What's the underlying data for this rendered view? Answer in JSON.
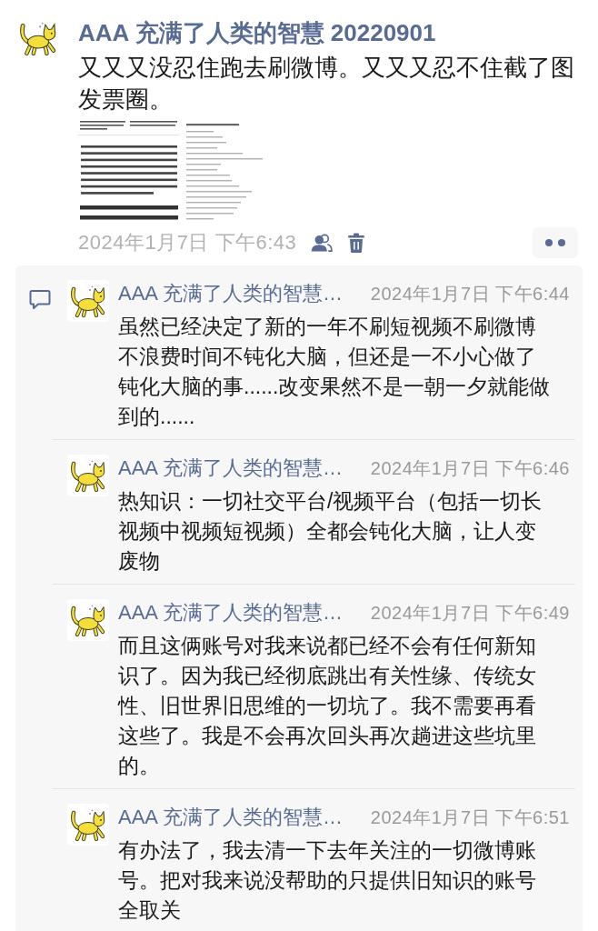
{
  "post": {
    "author": "AAA 充满了人类的智慧 20220901",
    "text": "又又又没忍住跑去刷微博。又又又忍不住截了图发票圈。",
    "time": "2024年1月7日 下午6:43"
  },
  "comments": [
    {
      "author": "AAA 充满了人类的智慧…",
      "time": "2024年1月7日 下午6:44",
      "text": "虽然已经决定了新的一年不刷短视频不刷微博不浪费时间不钝化大脑，但还是一不小心做了钝化大脑的事......改变果然不是一朝一夕就能做到的......"
    },
    {
      "author": "AAA 充满了人类的智慧…",
      "time": "2024年1月7日 下午6:46",
      "text": "热知识：一切社交平台/视频平台（包括一切长视频中视频短视频）全都会钝化大脑，让人变废物"
    },
    {
      "author": "AAA 充满了人类的智慧…",
      "time": "2024年1月7日 下午6:49",
      "text": "而且这俩账号对我来说都已经不会有任何新知识了。因为我已经彻底跳出有关性缘、传统女性、旧世界旧思维的一切坑了。我不需要再看这些了。我是不会再次回头再次趟进这些坑里的。"
    },
    {
      "author": "AAA 充满了人类的智慧…",
      "time": "2024年1月7日 下午6:51",
      "text": "有办法了，我去清一下去年关注的一切微博账号。把对我来说没帮助的只提供旧知识的账号全取关"
    }
  ]
}
